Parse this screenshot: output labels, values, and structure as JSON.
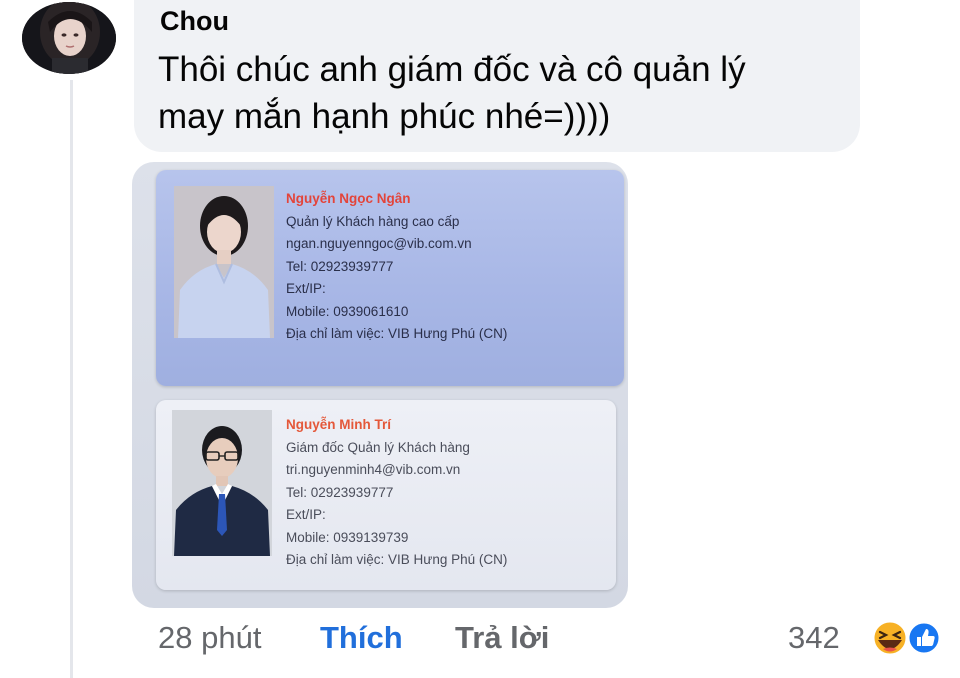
{
  "comment": {
    "author": "Chou",
    "text_line1": "Thôi chúc anh giám đốc và cô quản lý",
    "text_line2": "may mắn hạnh phúc nhé=))))"
  },
  "cards": [
    {
      "name": "Nguyễn Ngọc Ngân",
      "title": "Quản lý Khách hàng cao cấp",
      "email": "ngan.nguyenngoc@vib.com.vn",
      "tel": "Tel: 02923939777",
      "ext": "Ext/IP:",
      "mobile": "Mobile: 0939061610",
      "address": "Địa chỉ làm việc: VIB Hưng Phú (CN)"
    },
    {
      "name": "Nguyễn Minh Trí",
      "title": "Giám đốc Quản lý Khách hàng",
      "email": "tri.nguyenminh4@vib.com.vn",
      "tel": "Tel: 02923939777",
      "ext": "Ext/IP:",
      "mobile": "Mobile: 0939139739",
      "address": "Địa chỉ làm việc: VIB Hưng Phú (CN)"
    }
  ],
  "footer": {
    "time": "28 phút",
    "like_label": "Thích",
    "reply_label": "Trả lời",
    "reaction_count": "342",
    "reaction_icons": [
      "haha-icon",
      "like-icon"
    ]
  },
  "colors": {
    "like_blue": "#216fdb",
    "bubble_bg": "#f0f2f5",
    "muted_text": "#65676b",
    "name_red": "#e3443a"
  }
}
